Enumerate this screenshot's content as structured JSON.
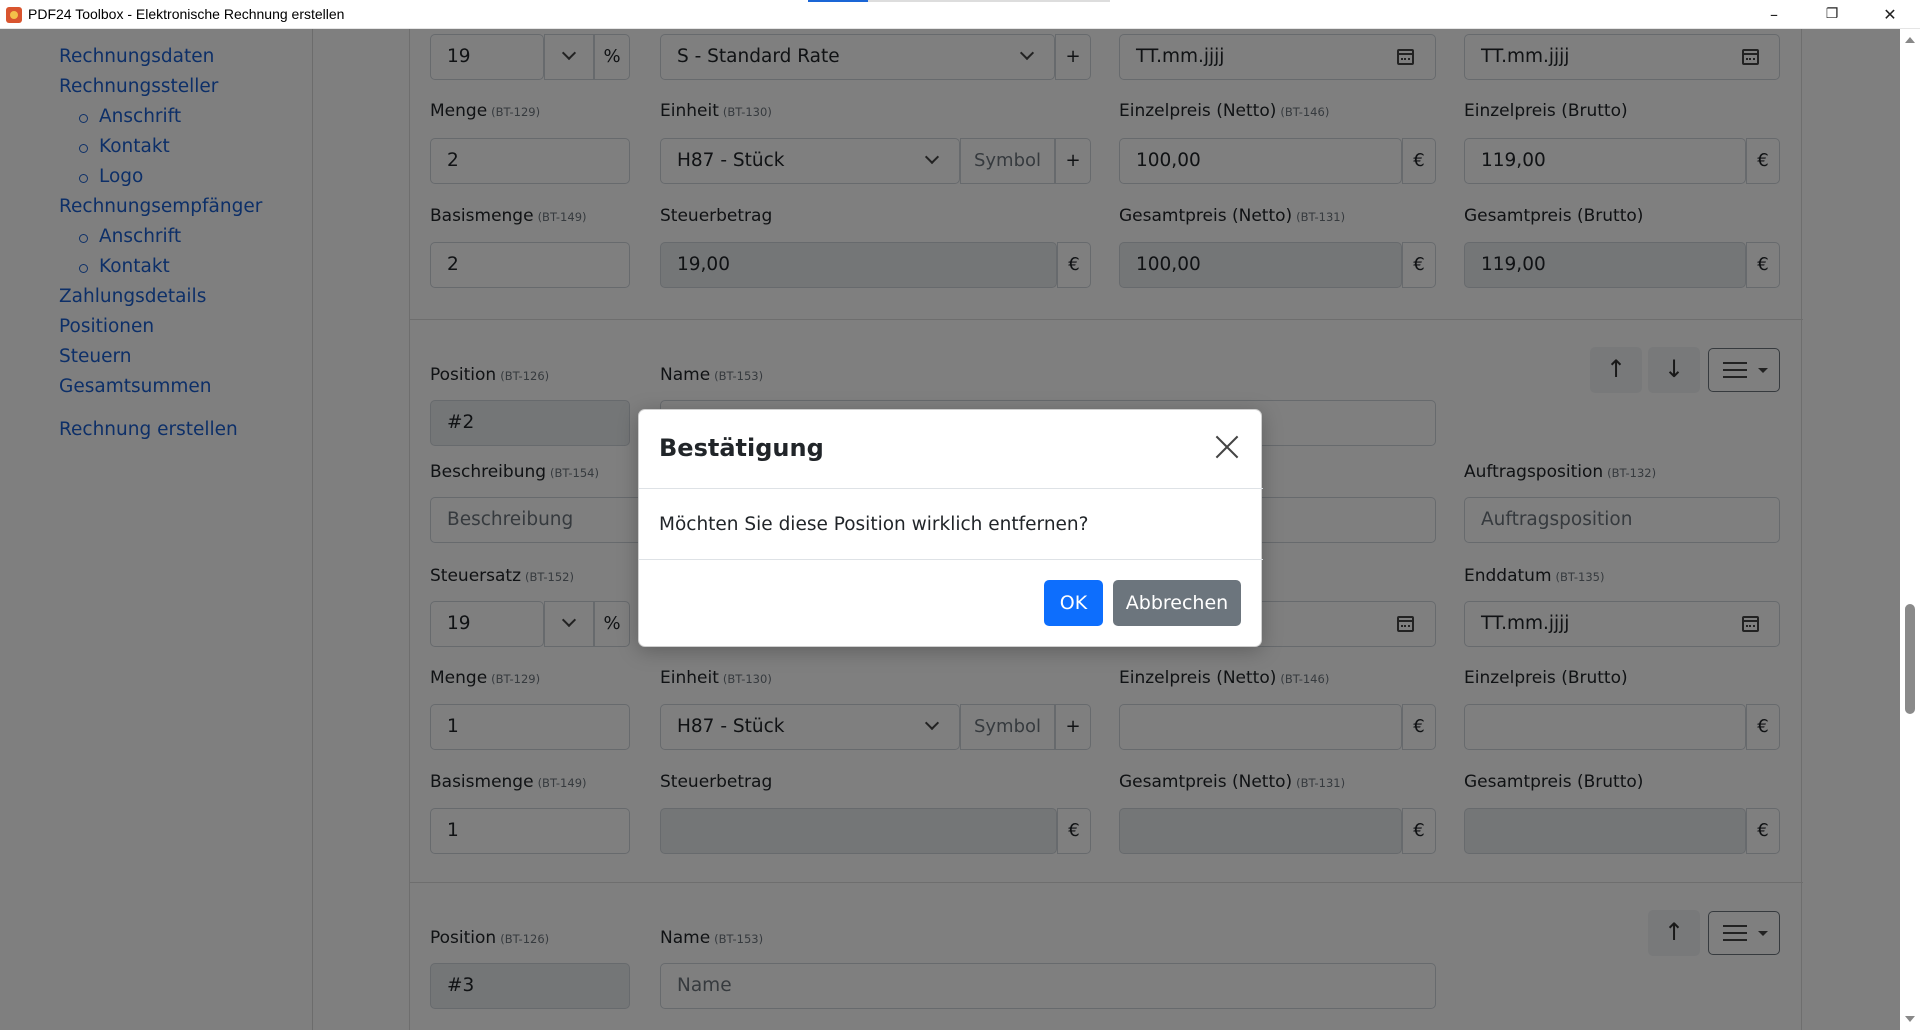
{
  "window": {
    "title": "PDF24 Toolbox - Elektronische Rechnung erstellen",
    "minimize": "–",
    "maximize": "❐",
    "close": "✕"
  },
  "sidebar": {
    "items": [
      {
        "label": "Rechnungsdaten"
      },
      {
        "label": "Rechnungssteller"
      },
      {
        "label": "Anschrift"
      },
      {
        "label": "Kontakt"
      },
      {
        "label": "Logo"
      },
      {
        "label": "Rechnungsempfänger"
      },
      {
        "label": "Anschrift"
      },
      {
        "label": "Kontakt"
      },
      {
        "label": "Zahlungsdetails"
      },
      {
        "label": "Positionen"
      },
      {
        "label": "Steuern"
      },
      {
        "label": "Gesamtsummen"
      },
      {
        "label": "Rechnung erstellen"
      }
    ]
  },
  "labels": {
    "menge": "Menge",
    "menge_code": "(BT-129)",
    "einheit": "Einheit",
    "einheit_code": "(BT-130)",
    "einzel_netto": "Einzelpreis (Netto)",
    "einzel_netto_code": "(BT-146)",
    "einzel_brutto": "Einzelpreis (Brutto)",
    "basismenge": "Basismenge",
    "basismenge_code": "(BT-149)",
    "steuerbetrag": "Steuerbetrag",
    "gesamt_netto": "Gesamtpreis (Netto)",
    "gesamt_netto_code": "(BT-131)",
    "gesamt_brutto": "Gesamtpreis (Brutto)",
    "position": "Position",
    "position_code": "(BT-126)",
    "name": "Name",
    "name_code": "(BT-153)",
    "beschreibung": "Beschreibung",
    "beschreibung_code": "(BT-154)",
    "auftragsposition": "Auftragsposition",
    "auftragsposition_code": "(BT-132)",
    "steuersatz": "Steuersatz",
    "steuersatz_code": "(BT-152)",
    "enddatum": "Enddatum",
    "enddatum_code": "(BT-135)"
  },
  "common": {
    "percent": "%",
    "plus": "+",
    "euro": "€",
    "symbol_placeholder": "Symbol",
    "date_placeholder": "TT.mm.jjjj",
    "up_arrow": "↑",
    "down_arrow": "↓"
  },
  "position1": {
    "tax_rate": "19",
    "tax_category": "S - Standard Rate",
    "menge": "2",
    "einheit": "H87 - Stück",
    "einzel_netto": "100,00",
    "einzel_brutto": "119,00",
    "basismenge": "2",
    "steuerbetrag": "19,00",
    "gesamt_netto": "100,00",
    "gesamt_brutto": "119,00"
  },
  "position2": {
    "position": "#2",
    "beschreibung_placeholder": "Beschreibung",
    "auftragsposition_placeholder": "Auftragsposition",
    "tax_rate": "19",
    "menge": "1",
    "einheit": "H87 - Stück",
    "basismenge": "1"
  },
  "position3": {
    "position": "#3",
    "name_placeholder": "Name"
  },
  "modal": {
    "title": "Bestätigung",
    "message": "Möchten Sie diese Position wirklich entfernen?",
    "ok": "OK",
    "cancel": "Abbrechen"
  }
}
